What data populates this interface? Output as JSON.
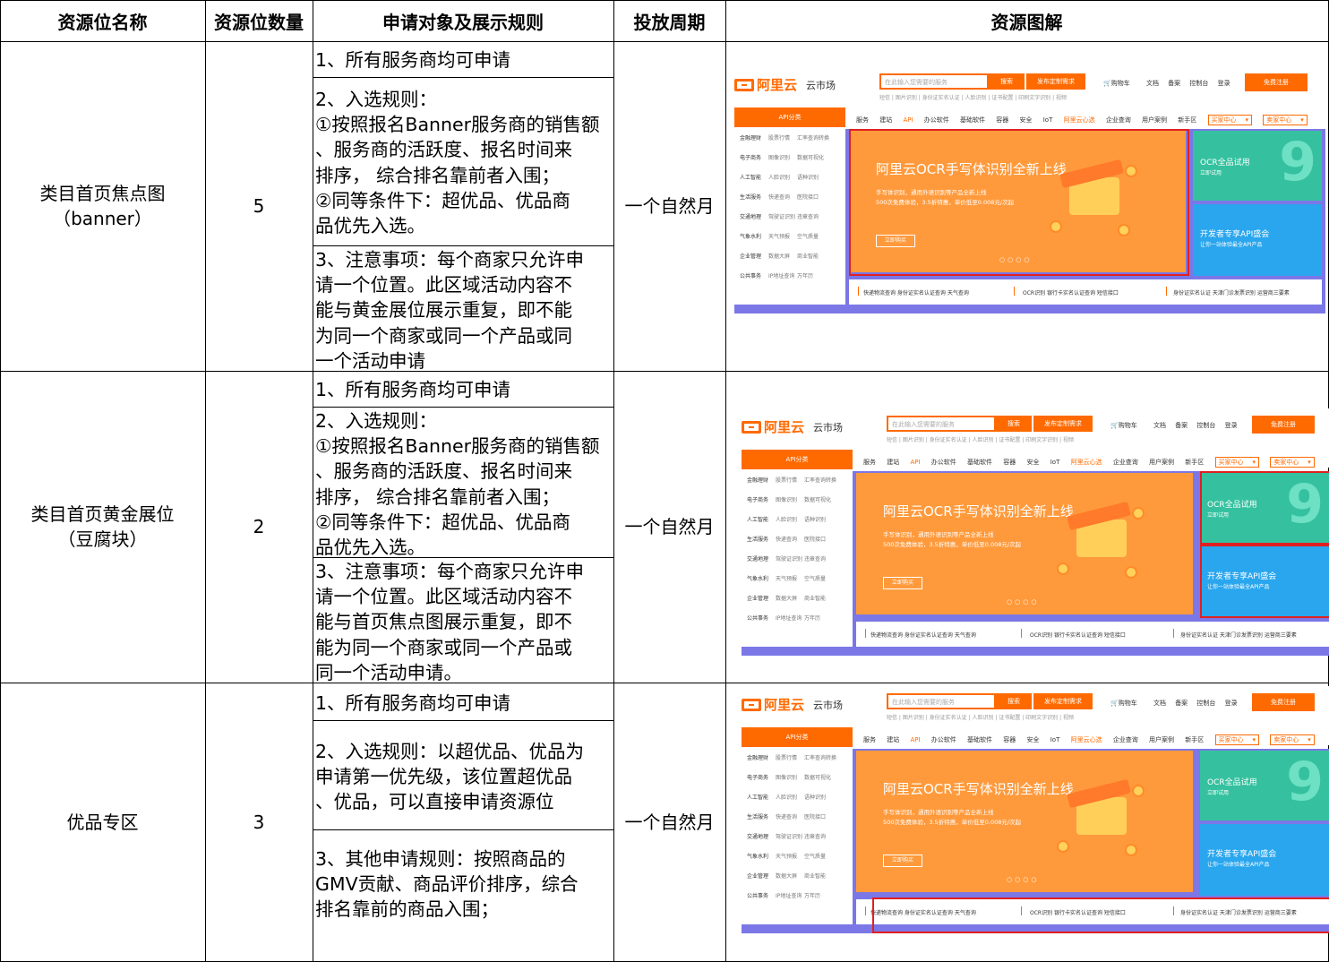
{
  "header": {
    "name": "资源位名称",
    "count": "资源位数量",
    "rules": "申请对象及展示规则",
    "period": "投放周期",
    "diagram": "资源图解"
  },
  "rows": [
    {
      "name_line1": "类目首页焦点图",
      "name_line2": "（banner）",
      "count": "5",
      "period": "一个自然月",
      "rule1": "1、所有服务商均可申请",
      "rule2_lines": [
        "2、入选规则：",
        "①按照报名Banner服务商的销售额",
        "、服务商的活跃度、报名时间来",
        "排序， 综合排名靠前者入围；",
        "②同等条件下：超优品、优品商",
        "品优先入选。"
      ],
      "rule3_lines": [
        "3、注意事项：每个商家只允许申",
        "请一个位置。此区域活动内容不",
        "能与黄金展位展示重复，即不能",
        "为同一个商家或同一个产品或同",
        "一个活动申请"
      ]
    },
    {
      "name_line1": "类目首页黄金展位",
      "name_line2": "（豆腐块）",
      "count": "2",
      "period": "一个自然月",
      "rule1": "1、所有服务商均可申请",
      "rule2_lines": [
        "2、入选规则：",
        "①按照报名Banner服务商的销售额",
        "、服务商的活跃度、报名时间来",
        "排序， 综合排名靠前者入围；",
        "②同等条件下：超优品、优品商",
        "品优先入选。"
      ],
      "rule3_lines": [
        "3、注意事项：每个商家只允许申",
        "请一个位置。此区域活动内容不",
        "能与首页焦点图展示重复，即不",
        "能为同一个商家或同一个产品或",
        "同一个活动申请。"
      ]
    },
    {
      "name_line1": "优品专区",
      "name_line2": "",
      "count": "3",
      "period": "一个自然月",
      "rule1": "1、所有服务商均可申请",
      "rule2_lines": [
        "2、入选规则：以超优品、优品为",
        "申请第一优先级，该位置超优品",
        "、优品，可以直接申请资源位"
      ],
      "rule3_lines": [
        "3、其他申请规则：按照商品的",
        "GMV贡献、商品评价排序，综合",
        "排名靠前的商品入围；"
      ]
    }
  ],
  "screenshot": {
    "logo": "阿里云",
    "logo_sub": "云市场",
    "search_placeholder": "在此输入您需要的服务",
    "search_button": "搜索",
    "publish_button": "发布定制需求",
    "hot_words": "短信 | 图片识别 | 身份证实名认证 | 人脸识别 | 证书配置 | 印刷文字识别 | 视频",
    "top_links": [
      "购物车",
      "文档",
      "备案",
      "控制台",
      "登录"
    ],
    "register_button": "免费注册",
    "category_button": "API分类",
    "nav_items": [
      "服务",
      "建站",
      "API",
      "办公软件",
      "基础软件",
      "容器",
      "安全",
      "IoT",
      "阿里云心选",
      "企业查询",
      "用户案例",
      "新手区"
    ],
    "nav_select1": "买家中心",
    "nav_select2": "卖家中心",
    "side_rows": [
      [
        "金融理财",
        "股票行情",
        "汇率查询转换"
      ],
      [
        "电子商务",
        "图像识别",
        "数据可视化"
      ],
      [
        "人工智能",
        "人脸识别",
        "语种识别"
      ],
      [
        "生活服务",
        "快递查询",
        "医院接口"
      ],
      [
        "交通地理",
        "驾驶证识别",
        "违章查询"
      ],
      [
        "气象水利",
        "天气预报",
        "空气质量"
      ],
      [
        "企业管理",
        "数据大屏",
        "商业智能"
      ],
      [
        "公共事务",
        "IP地址查询",
        "万年历"
      ]
    ],
    "banner_title": "阿里云OCR手写体识别全新上线",
    "banner_sub1": "手写体识别，通用外语识别等产品全新上线",
    "banner_sub2": "500次免费体验，3.5折特惠，单价低至0.008元/次起",
    "banner_button": "立即购买",
    "tile1_title": "OCR全品试用",
    "tile1_sub": "立即试用",
    "tile2_title": "开发者专享API盛会",
    "tile2_sub": "让你一站体验最全API产品",
    "strip1": "快递物流查询  身份证实名认证查询  天气查询",
    "strip2": "OCR识别 银行卡实名认证查询  短信接口",
    "strip3": "身份证实名认证 天津门诊发票识别 运营商三要素",
    "colors": {
      "brand": "#ff6a00",
      "highlight": "#e02020",
      "banner": "#ff9a3c",
      "tile1": "#35c19f",
      "tile2": "#2aa6ee",
      "frame": "#7b77e6"
    }
  }
}
